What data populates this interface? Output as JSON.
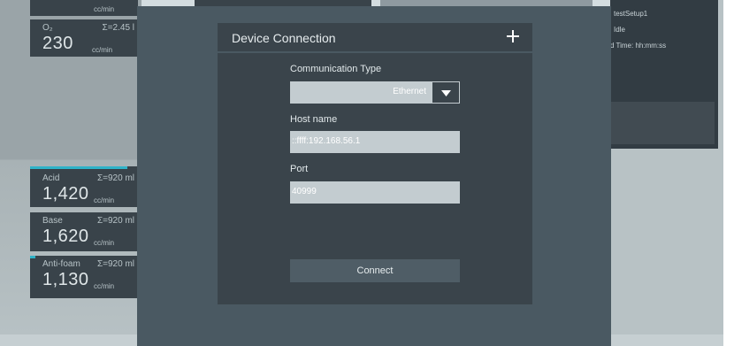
{
  "flow_cards": [
    {
      "name": "O₂",
      "total": "Σ=2.45 l",
      "value": "230",
      "unit": "cc/min"
    },
    {
      "name": "Acid",
      "total": "Σ=920 ml",
      "value": "1,420",
      "unit": "cc/min"
    },
    {
      "name": "Base",
      "total": "Σ=920 ml",
      "value": "1,620",
      "unit": "cc/min"
    },
    {
      "name": "Anti-foam",
      "total": "Σ=920 ml",
      "value": "1,130",
      "unit": "cc/min"
    }
  ],
  "top_partial": {
    "unit": "cc/min"
  },
  "status_panel": {
    "setup": "testSetup1",
    "state": "Idle",
    "time": "d Time: hh:mm:ss"
  },
  "dialog": {
    "title": "Device Connection",
    "close_icon": "plus-icon",
    "communication_type_label": "Communication Type",
    "communication_type_value": "Ethernet",
    "host_name_label": "Host name",
    "host_name_value": "::ffff:192.168.56.1",
    "port_label": "Port",
    "port_value": "40999",
    "connect_label": "Connect"
  },
  "colors": {
    "accent": "#2fb3c8",
    "dialog_bg": "#3a444b",
    "overlay_bg": "#4a5962",
    "field_bg": "#c3ccd0"
  }
}
